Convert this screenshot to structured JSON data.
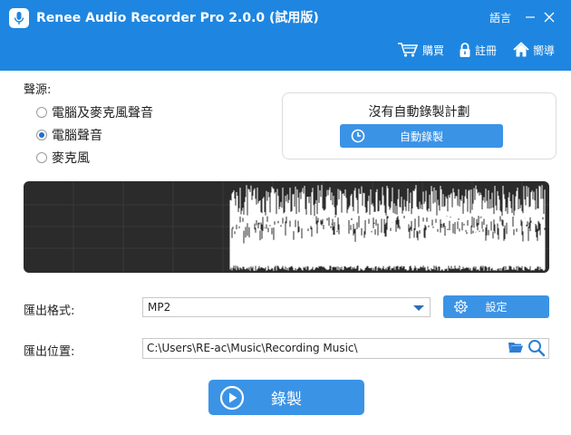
{
  "window": {
    "title": "Renee Audio Recorder Pro 2.0.0 (試用版)",
    "language_label": "語言"
  },
  "toolbar": {
    "buy_label": "購買",
    "register_label": "註冊",
    "guide_label": "嚮導"
  },
  "source": {
    "label": "聲源:",
    "options": [
      {
        "label": "電腦及麥克風聲音",
        "selected": false
      },
      {
        "label": "電腦聲音",
        "selected": true
      },
      {
        "label": "麥克風",
        "selected": false
      }
    ]
  },
  "schedule": {
    "status_text": "沒有自動錄製計劃",
    "auto_button_label": "自動錄製"
  },
  "export": {
    "format_label": "匯出格式:",
    "format_value": "MP2",
    "settings_button_label": "設定",
    "location_label": "匯出位置:",
    "location_value": "C:\\Users\\RE-ac\\Music\\Recording Music\\"
  },
  "record": {
    "button_label": "錄製"
  },
  "colors": {
    "titlebar": "#1e86e0",
    "button": "#3b93e6",
    "waveform_bg": "#2b2b2b",
    "waveform_fg": "#ffffff"
  }
}
